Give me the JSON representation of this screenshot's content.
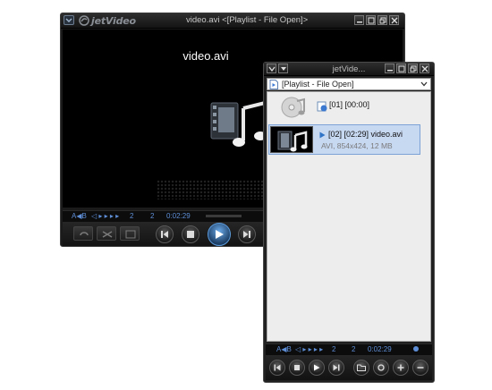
{
  "player": {
    "logo_text": "jetVideo",
    "window_title": "video.avi   <[Playlist - File Open]>",
    "video_title": "video.avi",
    "info": {
      "mode": "A◀B",
      "rate": "◁ ▸ ▸ ▸ ▸",
      "track": "2",
      "total": "2",
      "time": "0:02:29"
    }
  },
  "playlist": {
    "window_title": "jetVide...",
    "dropdown_value": "[Playlist - File Open]",
    "items": [
      {
        "label": "[01] [00:00]"
      },
      {
        "label": "[02] [02:29]  video.avi",
        "details": "AVI, 854x424, 12 MB"
      }
    ],
    "info": {
      "mode": "A◀B",
      "rate": "◁ ▸ ▸ ▸ ▸",
      "track": "2",
      "total": "2",
      "time": "0:02:29"
    }
  },
  "colors": {
    "accent": "#5e8ed6",
    "selection": "#c7d8f1",
    "frame": "#1a1a1a"
  }
}
